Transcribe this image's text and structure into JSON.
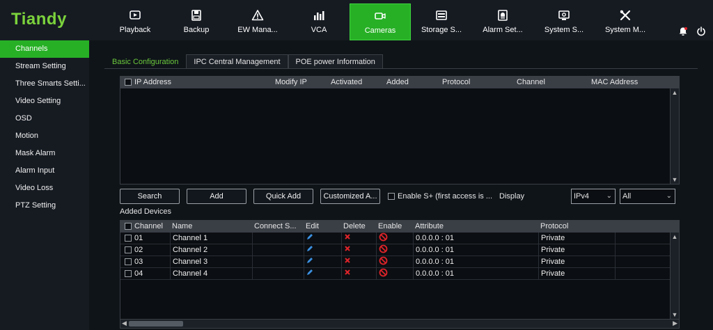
{
  "brand": "Tiandy",
  "nav": [
    {
      "label": "Playback",
      "icon": "play-icon"
    },
    {
      "label": "Backup",
      "icon": "save-icon"
    },
    {
      "label": "EW Mana...",
      "icon": "warning-icon"
    },
    {
      "label": "VCA",
      "icon": "chart-icon"
    },
    {
      "label": "Cameras",
      "icon": "camera-icon"
    },
    {
      "label": "Storage S...",
      "icon": "storage-icon"
    },
    {
      "label": "Alarm Set...",
      "icon": "alarm-icon"
    },
    {
      "label": "System S...",
      "icon": "monitor-gear-icon"
    },
    {
      "label": "System M...",
      "icon": "tools-icon"
    }
  ],
  "active_nav": "Cameras",
  "sidebar": [
    {
      "label": "Channels"
    },
    {
      "label": "Stream Setting"
    },
    {
      "label": "Three Smarts Setti..."
    },
    {
      "label": "Video Setting"
    },
    {
      "label": "OSD"
    },
    {
      "label": "Motion"
    },
    {
      "label": "Mask Alarm"
    },
    {
      "label": "Alarm Input"
    },
    {
      "label": "Video Loss"
    },
    {
      "label": "PTZ Setting"
    }
  ],
  "tabs": [
    {
      "label": "Basic Configuration"
    },
    {
      "label": "IPC Central Management"
    },
    {
      "label": "POE power Information"
    }
  ],
  "search_table": {
    "headers": [
      "IP Address",
      "Modify IP",
      "Activated",
      "Added",
      "Protocol",
      "Channel",
      "MAC Address"
    ]
  },
  "buttons": {
    "search": "Search",
    "add": "Add",
    "quick_add": "Quick Add",
    "customized_add": "Customized A..."
  },
  "enable_s": "Enable S+ (first access is ...",
  "display_label": "Display",
  "ip_select": "IPv4",
  "filter_select": "All",
  "added_devices_label": "Added Devices",
  "devices_table": {
    "headers": [
      "Channel",
      "Name",
      "Connect S...",
      "Edit",
      "Delete",
      "Enable",
      "Attribute",
      "Protocol"
    ],
    "rows": [
      {
        "channel": "01",
        "name": "Channel 1",
        "attribute": "0.0.0.0 : 01",
        "protocol": "Private"
      },
      {
        "channel": "02",
        "name": "Channel 2",
        "attribute": "0.0.0.0 : 01",
        "protocol": "Private"
      },
      {
        "channel": "03",
        "name": "Channel 3",
        "attribute": "0.0.0.0 : 01",
        "protocol": "Private"
      },
      {
        "channel": "04",
        "name": "Channel 4",
        "attribute": "0.0.0.0 : 01",
        "protocol": "Private"
      }
    ]
  },
  "colors": {
    "accent": "#27b026",
    "brand": "#7bd23c",
    "delete": "#e0242a"
  }
}
